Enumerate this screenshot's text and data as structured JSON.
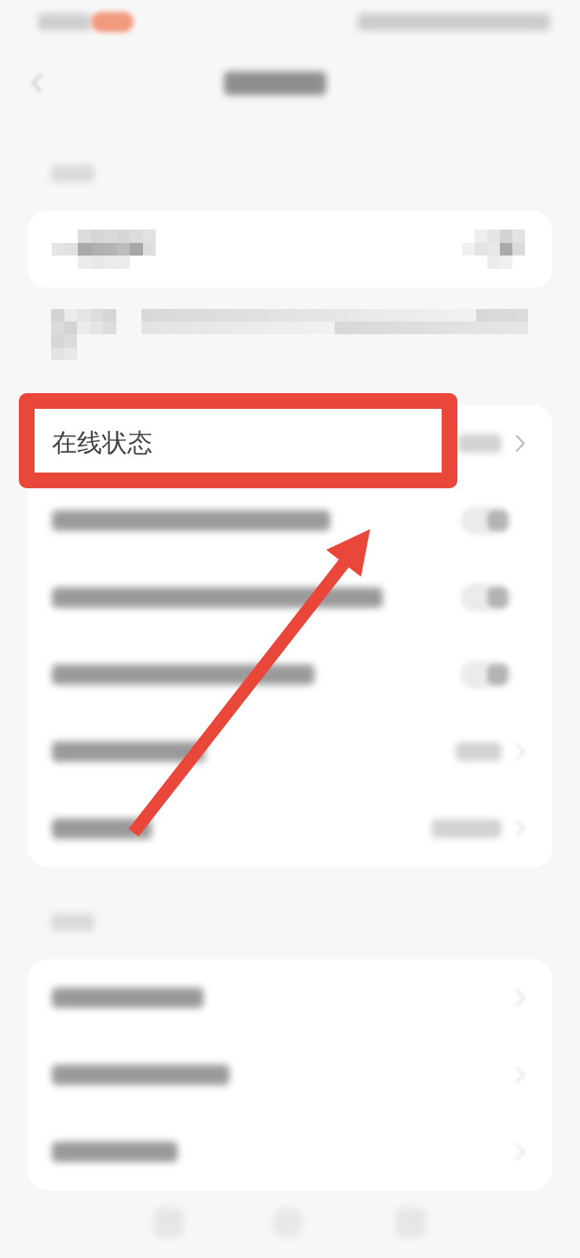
{
  "cards": [
    {
      "rows": [
        {
          "kind": "pixelated",
          "highlighted": false
        }
      ]
    },
    {
      "rows": [
        {
          "kind": "value_link",
          "label": "在线状态",
          "highlighted": true
        },
        {
          "kind": "toggle",
          "on": true,
          "highlighted": false
        },
        {
          "kind": "toggle",
          "on": true,
          "highlighted": false
        },
        {
          "kind": "toggle",
          "on": true,
          "highlighted": false
        },
        {
          "kind": "value_link",
          "highlighted": false
        },
        {
          "kind": "value_link",
          "highlighted": false
        }
      ]
    },
    {
      "rows": [
        {
          "kind": "link",
          "highlighted": false
        },
        {
          "kind": "link",
          "highlighted": false
        },
        {
          "kind": "link",
          "highlighted": false
        }
      ]
    }
  ]
}
